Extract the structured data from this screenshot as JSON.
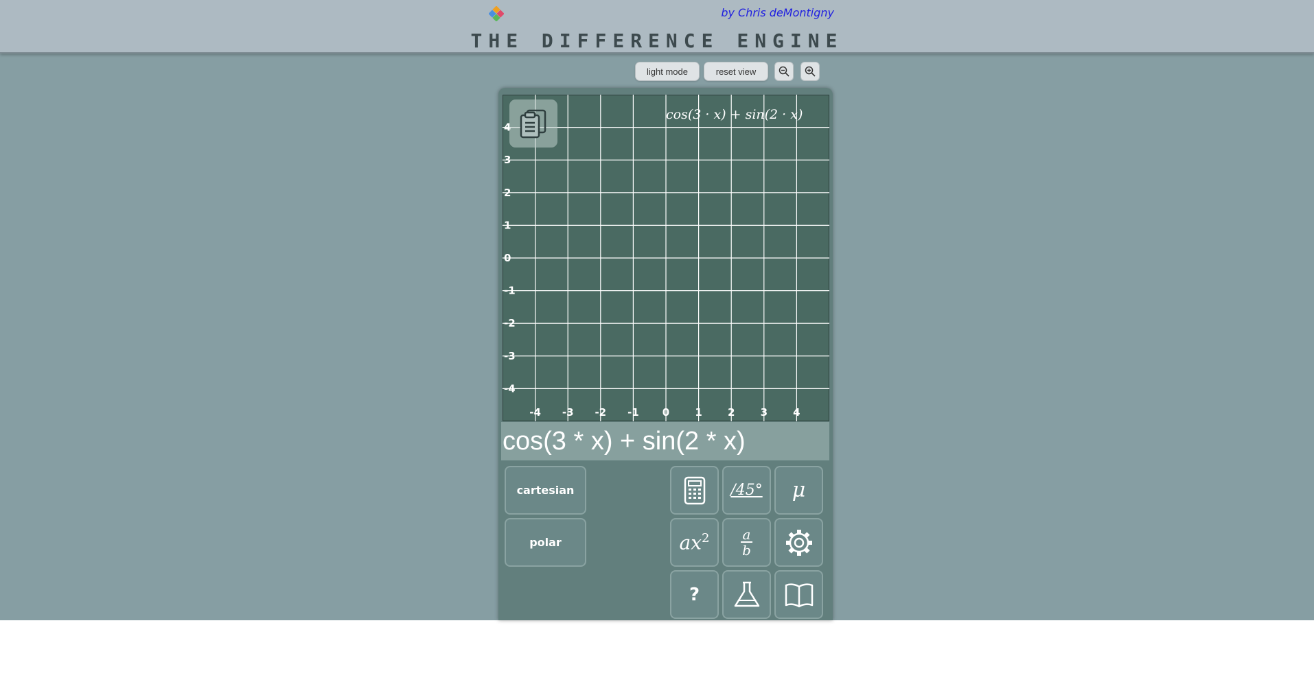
{
  "header": {
    "byline": "by Chris deMontigny",
    "title": "THE DIFFERENCE ENGINE"
  },
  "toolbar": {
    "light_mode_label": "light mode",
    "reset_view_label": "reset view",
    "zoom_out_icon": "zoom-out-icon",
    "zoom_in_icon": "zoom-in-icon"
  },
  "graph": {
    "expression_label": "cos(3 · x) + sin(2 · x)",
    "colors": {
      "background": "#4a6a62",
      "grid": "#ffffff"
    }
  },
  "chart_data": {
    "type": "line",
    "series": [],
    "xlim": [
      -5,
      5
    ],
    "ylim": [
      -5,
      5
    ],
    "x_ticks": [
      -4,
      -3,
      -2,
      -1,
      0,
      1,
      2,
      3,
      4
    ],
    "y_ticks": [
      4,
      3,
      2,
      1,
      0,
      -1,
      -2,
      -3,
      -4
    ],
    "grid": true
  },
  "input": {
    "expression": "cos(3 * x) + sin(2 * x)"
  },
  "mode_buttons": {
    "cartesian": "cartesian",
    "polar": "polar"
  },
  "tools": {
    "angle_label": "/45°",
    "mu_label": "μ",
    "power_base": "ax",
    "power_exp": "2",
    "frac_num": "a",
    "frac_den": "b",
    "help_label": "?"
  }
}
